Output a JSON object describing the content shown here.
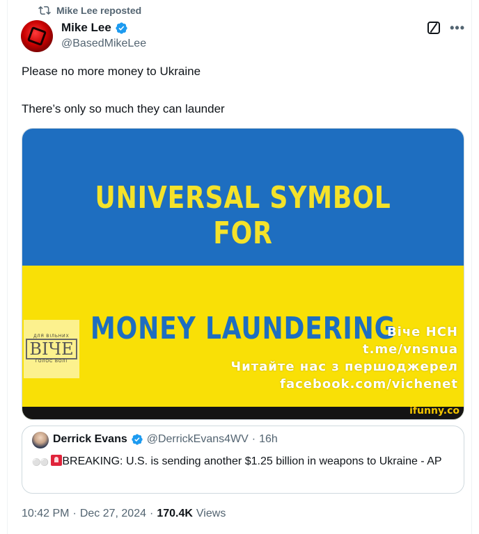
{
  "repost": {
    "text": "Mike Lee reposted",
    "icon": "repost-icon"
  },
  "author": {
    "name": "Mike Lee",
    "handle": "@BasedMikeLee",
    "verified": true
  },
  "tweet": {
    "line1": "Please no more money to Ukraine",
    "line2": "There’s only so much they can launder"
  },
  "media": {
    "headline_top": "UNIVERSAL SYMBOL FOR",
    "headline_bottom": "MONEY LAUNDERING",
    "watermark_logo": {
      "top": "ДЛЯ ВІЛЬНИХ",
      "main": "ВІЧЕ",
      "bottom": "ГОЛОС ВОЛІ"
    },
    "watermark_lines": [
      "Віче НСН",
      "t.me/vnsnua",
      "Читайте нас з першоджерел",
      "facebook.com/vichenet"
    ],
    "credit": "ifunny.co",
    "colors": {
      "blue": "#1e6ec0",
      "yellow": "#f9e006"
    }
  },
  "quote": {
    "name": "Derrick Evans",
    "handle": "@DerrickEvans4WV",
    "separator": "·",
    "time": "16h",
    "text": "BREAKING: U.S. is sending another $1.25 billion in weapons to Ukraine - AP"
  },
  "meta": {
    "time": "10:42 PM",
    "dot1": "·",
    "date": "Dec 27, 2024",
    "dot2": "·",
    "views_count": "170.4K",
    "views_label": "Views"
  },
  "colors": {
    "accent": "#1d9bf0",
    "secondary_text": "#536471"
  }
}
